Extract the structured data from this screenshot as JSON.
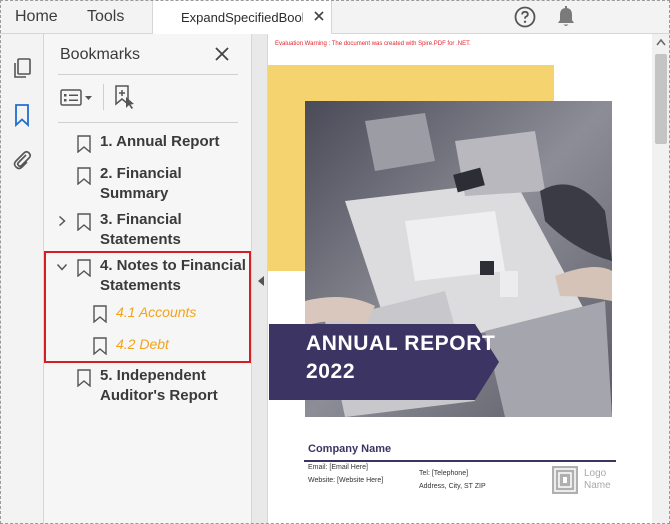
{
  "tabs": {
    "home": "Home",
    "tools": "Tools",
    "document": "ExpandSpecifiedBookmarks.pdf"
  },
  "header_icons": [
    "close-icon",
    "help-icon",
    "bell-icon"
  ],
  "rail_icons": [
    "copy-pages-icon",
    "bookmark-icon",
    "paperclip-icon"
  ],
  "bookmarks_panel": {
    "title": "Bookmarks",
    "items": [
      {
        "label_lines": [
          "1. Annual Report"
        ],
        "expandable": false,
        "level": 1
      },
      {
        "label_lines": [
          "2. Financial",
          "Summary"
        ],
        "expandable": false,
        "level": 1
      },
      {
        "label_lines": [
          "3. Financial",
          "Statements"
        ],
        "expandable": true,
        "expanded": false,
        "level": 1
      },
      {
        "label_lines": [
          "4. Notes to Financial",
          "Statements"
        ],
        "expandable": true,
        "expanded": true,
        "level": 1
      },
      {
        "label_lines": [
          "4.1 Accounts"
        ],
        "expandable": false,
        "level": 2
      },
      {
        "label_lines": [
          "4.2 Debt"
        ],
        "expandable": false,
        "level": 2
      },
      {
        "label_lines": [
          "5. Independent",
          "Auditor's Report"
        ],
        "expandable": false,
        "level": 1
      }
    ]
  },
  "document": {
    "evaluation_warning": "Evaluation Warning : The document was created with Spire.PDF for .NET.",
    "cover_title_lines": [
      "ANNUAL REPORT",
      "2022"
    ],
    "company_name": "Company Name",
    "email": "Email: [Email Here]",
    "website": "Website: [Website Here]",
    "telephone": "Tel: [Telephone]",
    "address": "Address, City, ST ZIP",
    "logo_lines": [
      "Logo",
      "Name"
    ]
  },
  "colors": {
    "accent_highlight": "#d41e24",
    "sub_bookmark": "#f2a31c",
    "cover_yellow": "#f5d470",
    "cover_purple": "#3c3563",
    "warning_red": "#e5242a"
  }
}
